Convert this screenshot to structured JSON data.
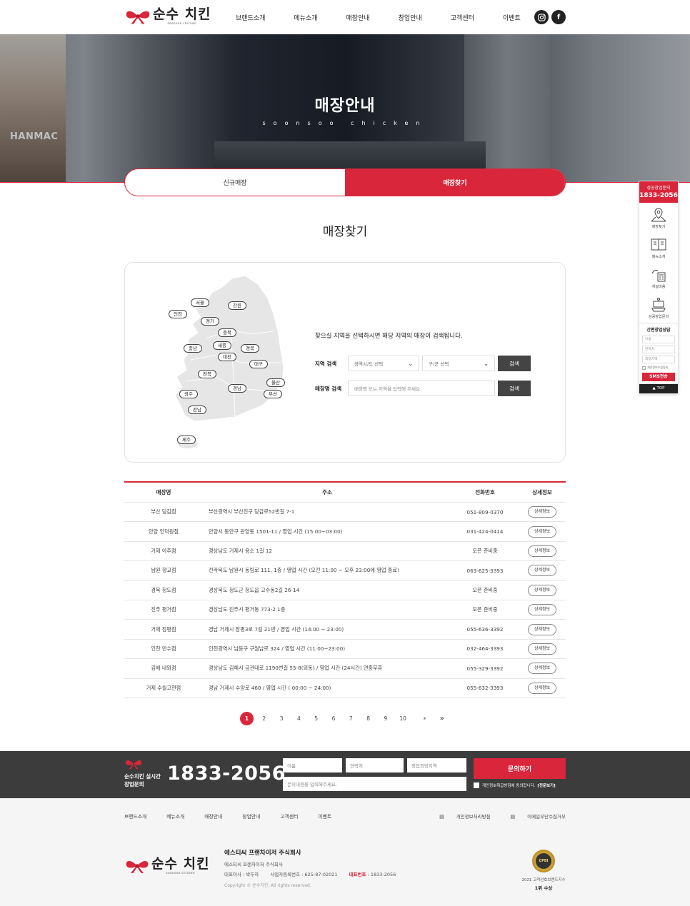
{
  "header": {
    "logo_kor": "순수 치킨",
    "logo_eng": "soonsoo chicken",
    "nav": [
      "브랜드소개",
      "메뉴소개",
      "매장안내",
      "창업안내",
      "고객센터",
      "이벤트"
    ],
    "sns": {
      "instagram": "instagram-icon",
      "facebook": "facebook-icon"
    }
  },
  "hero": {
    "title": "매장안내",
    "subtitle": "soonsoo chicken",
    "poster_text": "HANMAC"
  },
  "tabs": {
    "new_store": "신규매장",
    "find_store": "매장찾기"
  },
  "section_title": "매장찾기",
  "search": {
    "description": "찾으실 지역을 선택하시면 해당 지역의 매장이 검색됩니다.",
    "region_label": "지역 검색",
    "province_placeholder": "광역시/도 선택",
    "district_placeholder": "구/군 선택",
    "search_button": "검색",
    "name_label": "매장명 검색",
    "name_placeholder": "매장명 또는 지역을 입력해 주세요",
    "name_button": "검색"
  },
  "map_regions": [
    "서울",
    "강원",
    "인천",
    "경기",
    "충북",
    "세종",
    "충남",
    "대전",
    "경북",
    "대구",
    "전북",
    "울산",
    "경남",
    "부산",
    "광주",
    "전남",
    "제주"
  ],
  "table": {
    "headers": {
      "name": "매장명",
      "address": "주소",
      "tel": "전화번호",
      "detail": "상세정보"
    },
    "detail_label": "상세정보",
    "rows": [
      {
        "name": "부산 당감점",
        "address": "부산광역시 부산진구 당감로52번길 7-1",
        "tel": "051-809-0370"
      },
      {
        "name": "안양 인덕원점",
        "address": "안양시 동안구 관양동 1501-11 / 영업 시간 (15:00~03:00)",
        "tel": "031-424-0414"
      },
      {
        "name": "거제 아주점",
        "address": "경상남도 거제시 용소 1길 12",
        "tel": "오픈 준비중"
      },
      {
        "name": "남원 향교점",
        "address": "전라북도 남원시 동림로 111, 1층 / 영업 시간 (오전 11:00 ~ 오후 23:00에 영업 종료)",
        "tel": "063-625-3393"
      },
      {
        "name": "경북 청도점",
        "address": "경상북도 청도군 청도읍 고수동2길 26-14",
        "tel": "오픈 준비중"
      },
      {
        "name": "진주 평거점",
        "address": "경상남도 진주시 평거동 773-2 1층",
        "tel": "오픈 준비중"
      },
      {
        "name": "거제 장평점",
        "address": "경남 거제시 장평3로 7길 21번 / 영업 시간 (14:00 ~ 23:00)",
        "tel": "055-636-3392"
      },
      {
        "name": "인천 만수점",
        "address": "인천광역시 남동구 구월남로 324 / 영업 시간 (11:00~23:00)",
        "tel": "032-464-3393"
      },
      {
        "name": "김해 내외점",
        "address": "경상남도 김해시 금관대로 1190번길 55-8(외동) / 영업 시간 (24시간) 연중무휴",
        "tel": "055-329-3392"
      },
      {
        "name": "거제 수월고현점",
        "address": "경남 거제시 수양로 460 / 영업 시간 ( 00:00 ~ 24:00)",
        "tel": "055-632-3393"
      }
    ]
  },
  "pagination": {
    "pages": [
      "1",
      "2",
      "3",
      "4",
      "5",
      "6",
      "7",
      "8",
      "9",
      "10"
    ],
    "current": "1",
    "next": "›",
    "last": "»"
  },
  "cta": {
    "label_line1": "순수치킨 실시간",
    "label_line2": "창업문의",
    "phone": "1833-2056",
    "name_placeholder": "이름",
    "contact_placeholder": "연락처",
    "area_placeholder": "창업희망지역",
    "message_placeholder": "문의내용을 입력해주세요.",
    "submit": "문의하기",
    "agree_text": "개인정보취급방침에 동의합니다.",
    "agree_link": "[전문보기]"
  },
  "footer": {
    "nav": [
      "브랜드소개",
      "메뉴소개",
      "매장안내",
      "창업안내",
      "고객센터",
      "이벤트"
    ],
    "privacy": "개인정보처리방침",
    "email_refusal": "이메일무단수집거부",
    "company_title": "에스티씨 프랜차이저 주식회사",
    "company_name": "에스티씨 프랜차이저 주식회사",
    "ceo": "대표이사 : 박두하",
    "biz_no": "사업자등록번호 : 625-87-02021",
    "tel_label": "대표번호",
    "tel": " : 1833-2056",
    "copyright": "Copyright © 순수치킨. All rights reserved.",
    "award_line1": "2021 고객선호브랜드지수",
    "award_line2": "1위 수상",
    "award_seal": "CPBI"
  },
  "quick_menu": {
    "top_line1": "성공창업문의",
    "top_line2": "1833-2056",
    "items": [
      {
        "label": "매장찾기",
        "icon": "map-pin-icon"
      },
      {
        "label": "메뉴소개",
        "icon": "menu-book-icon"
      },
      {
        "label": "개설비용",
        "icon": "calculator-icon"
      },
      {
        "label": "성공창업문의",
        "icon": "consult-icon"
      }
    ],
    "form_title": "간편창업상담",
    "form_name": "이름",
    "form_contact": "연락처",
    "form_area": "희망지역",
    "form_agree": "개인정보수집동의",
    "form_submit": "SMS전송",
    "top_button": "▲ TOP"
  },
  "colors": {
    "accent": "#d9263a",
    "dark": "#3c3c3c"
  }
}
